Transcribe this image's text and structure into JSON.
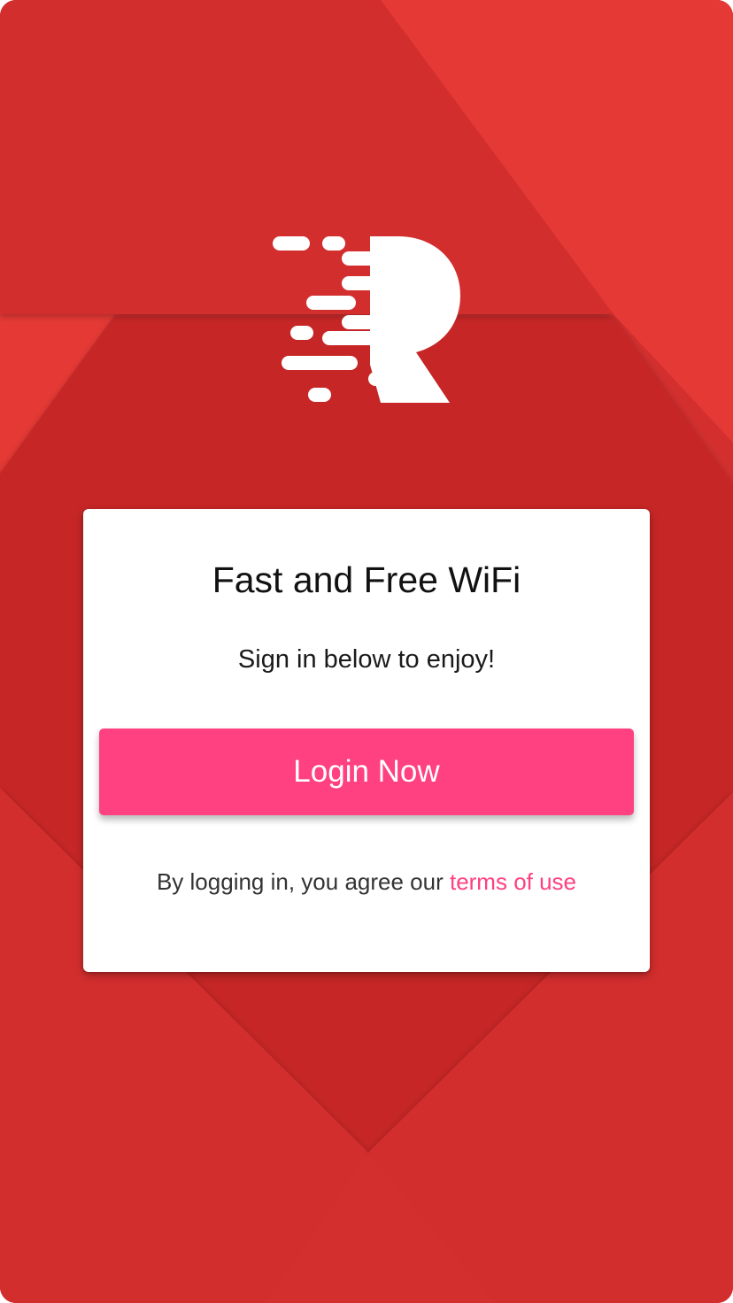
{
  "colors": {
    "accent": "#ff4081",
    "background_red": "#d32f2f",
    "background_red_light": "#e53935",
    "background_red_dark": "#c62828",
    "card": "#ffffff"
  },
  "brand": {
    "logo_icon": "r-speed-logo-icon"
  },
  "card": {
    "title": "Fast and Free WiFi",
    "subtitle": "Sign in below to enjoy!",
    "login_button_label": "Login Now",
    "terms_prefix": "By logging in, you agree our ",
    "terms_link_label": "terms of use"
  }
}
